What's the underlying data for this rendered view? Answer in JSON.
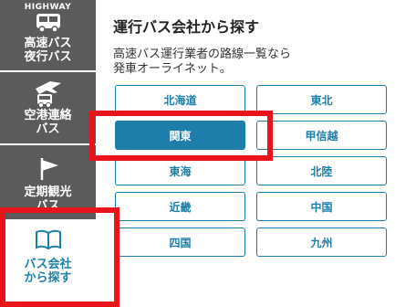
{
  "sidebar": {
    "highway_label": "HIGHWAY",
    "items": [
      {
        "label_line1": "高速バス",
        "label_line2": "夜行バス",
        "icon": "bus-icon"
      },
      {
        "label_line1": "空港連絡",
        "label_line2": "バス",
        "icon": "airport-bus-icon"
      },
      {
        "label_line1": "定期観光",
        "label_line2": "バス",
        "icon": "flag-icon"
      },
      {
        "label_line1": "バス会社",
        "label_line2": "から探す",
        "icon": "book-icon"
      }
    ]
  },
  "main": {
    "title": "運行バス会社から探す",
    "description_line1": "高速バス運行業者の路線一覧なら",
    "description_line2": "発車オーライネット。",
    "regions": [
      {
        "label": "北海道"
      },
      {
        "label": "東北"
      },
      {
        "label": "関東",
        "selected": true
      },
      {
        "label": "甲信越"
      },
      {
        "label": "東海"
      },
      {
        "label": "北陸"
      },
      {
        "label": "近畿"
      },
      {
        "label": "中国"
      },
      {
        "label": "四国"
      },
      {
        "label": "九州"
      }
    ]
  },
  "colors": {
    "accent": "#1d7fa9",
    "sidebar_bg": "#5b5b5b",
    "highlight": "#e8131b"
  }
}
